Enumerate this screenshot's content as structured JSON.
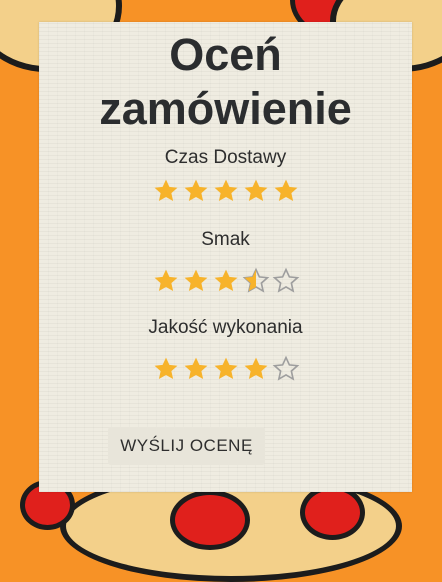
{
  "page": {
    "title": "Oceń zamówienie",
    "accent_color": "#f7b32b",
    "empty_star_color": "#9e9e9e",
    "background_color": "#f79226"
  },
  "ratings": [
    {
      "label": "Czas Dostawy",
      "value": 5,
      "max": 5
    },
    {
      "label": "Smak",
      "value": 3.5,
      "max": 5
    },
    {
      "label": "Jakość wykonania",
      "value": 4,
      "max": 5
    }
  ],
  "submit": {
    "label": "WYŚLIJ OCENĘ"
  }
}
